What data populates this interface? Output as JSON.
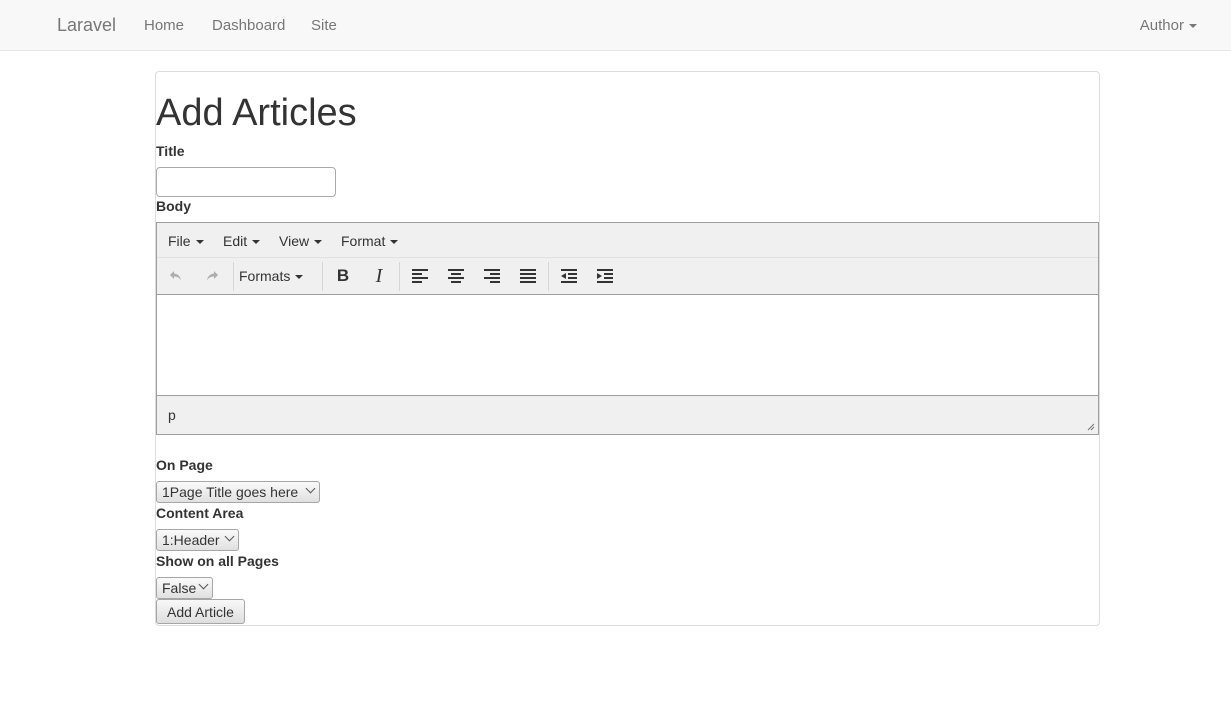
{
  "navbar": {
    "brand": "Laravel",
    "links": [
      "Home",
      "Dashboard",
      "Site"
    ],
    "user_menu": "Author"
  },
  "page": {
    "title": "Add Articles"
  },
  "form": {
    "title_label": "Title",
    "title_value": "",
    "body_label": "Body",
    "editor": {
      "menu": [
        "File",
        "Edit",
        "View",
        "Format"
      ],
      "toolbar": {
        "undo_icon": "undo-icon",
        "redo_icon": "redo-icon",
        "formats_label": "Formats",
        "bold_glyph": "B",
        "italic_glyph": "I",
        "align_icons": [
          "align-left-icon",
          "align-center-icon",
          "align-right-icon",
          "align-justify-icon"
        ],
        "indent_icons": [
          "outdent-icon",
          "indent-icon"
        ]
      },
      "status_path": "p"
    },
    "on_page_label": "On Page",
    "on_page_selected": "1Page Title goes here",
    "content_area_label": "Content Area",
    "content_area_selected": "1:Header",
    "show_all_label": "Show on all Pages",
    "show_all_selected": "False",
    "submit_label": "Add Article"
  }
}
